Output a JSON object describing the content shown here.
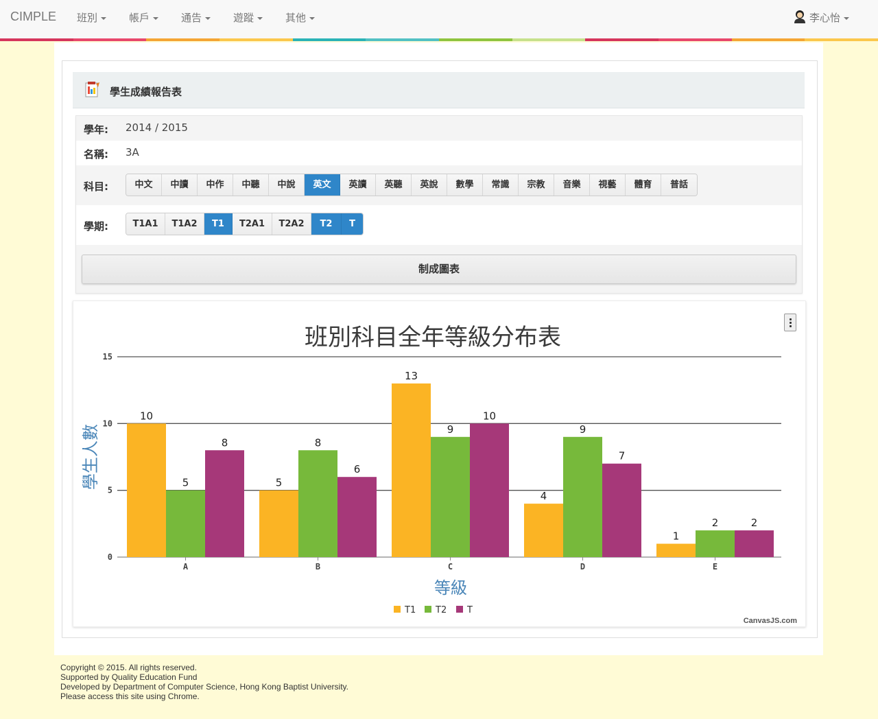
{
  "nav": {
    "brand": "CIMPLE",
    "items": [
      {
        "label": "班別"
      },
      {
        "label": "帳戶"
      },
      {
        "label": "通告"
      },
      {
        "label": "遊蹤"
      },
      {
        "label": "其他"
      }
    ],
    "user": "李心怡"
  },
  "colors": {
    "stripe": [
      "#d6355c",
      "#e8476c",
      "#f4a534",
      "#fbc74c",
      "#2bb3b7",
      "#52c1c4",
      "#8fc43f",
      "#c6e18c",
      "#d6355c",
      "#e8476c",
      "#f4a534",
      "#fbc74c"
    ],
    "active_button": "#2f86c9",
    "T1": "#FBB424",
    "T2": "#77B93B",
    "T": "#A63879"
  },
  "panel": {
    "title": "學生成績報告表",
    "title_icon": "report-icon"
  },
  "form": {
    "year_label": "學年:",
    "year_value": "2014 / 2015",
    "name_label": "名稱:",
    "name_value": "3A",
    "subject_label": "科目:",
    "subjects": [
      {
        "label": "中文",
        "active": false
      },
      {
        "label": "中讀",
        "active": false
      },
      {
        "label": "中作",
        "active": false
      },
      {
        "label": "中聽",
        "active": false
      },
      {
        "label": "中說",
        "active": false
      },
      {
        "label": "英文",
        "active": true
      },
      {
        "label": "英讀",
        "active": false
      },
      {
        "label": "英聽",
        "active": false
      },
      {
        "label": "英說",
        "active": false
      },
      {
        "label": "數學",
        "active": false
      },
      {
        "label": "常識",
        "active": false
      },
      {
        "label": "宗教",
        "active": false
      },
      {
        "label": "音樂",
        "active": false
      },
      {
        "label": "視藝",
        "active": false
      },
      {
        "label": "體育",
        "active": false
      },
      {
        "label": "普話",
        "active": false
      }
    ],
    "term_label": "學期:",
    "terms": [
      {
        "label": "T1A1",
        "active": false
      },
      {
        "label": "T1A2",
        "active": false
      },
      {
        "label": "T1",
        "active": true
      },
      {
        "label": "T2A1",
        "active": false
      },
      {
        "label": "T2A2",
        "active": false
      },
      {
        "label": "T2",
        "active": true
      },
      {
        "label": "T",
        "active": true
      }
    ],
    "make_chart": "制成圖表"
  },
  "chart_data": {
    "type": "bar",
    "title": "班別科目全年等級分布表",
    "xlabel": "等級",
    "ylabel": "學生人數",
    "categories": [
      "A",
      "B",
      "C",
      "D",
      "E"
    ],
    "series": [
      {
        "name": "T1",
        "values": [
          10,
          5,
          13,
          4,
          1
        ]
      },
      {
        "name": "T2",
        "values": [
          5,
          8,
          9,
          9,
          2
        ]
      },
      {
        "name": "T",
        "values": [
          8,
          6,
          10,
          7,
          2
        ]
      }
    ],
    "ylim": [
      0,
      15
    ],
    "yticks": [
      0,
      5,
      10,
      15
    ],
    "grid": true,
    "legend": "bottom",
    "credit": "CanvasJS.com"
  },
  "footer": {
    "lines": [
      "Copyright © 2015. All rights reserved.",
      "Supported by Quality Education Fund",
      "Developed by Department of Computer Science, Hong Kong Baptist University.",
      "Please access this site using Chrome."
    ]
  }
}
